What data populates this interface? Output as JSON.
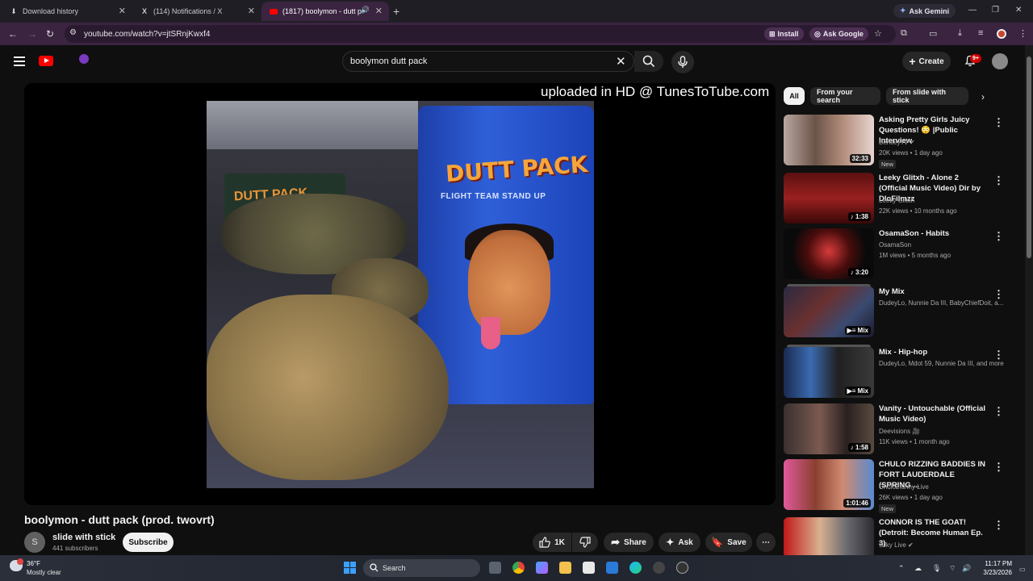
{
  "browser": {
    "tabs": [
      {
        "label": "Download history",
        "icon": "download-icon"
      },
      {
        "label": "(114) Notifications / X",
        "icon": "x-logo-icon"
      },
      {
        "label": "(1817) boolymon - dutt pac",
        "icon": "youtube-icon"
      }
    ],
    "ask_gemini": "Ask Gemini",
    "url": "youtube.com/watch?v=jtSRnjKwxf4",
    "install": "Install",
    "ask_google": "Ask Google"
  },
  "header": {
    "search_value": "boolymon dutt pack",
    "create_label": "Create",
    "notif_badge": "9+"
  },
  "player": {
    "watermark": "uploaded in HD @ TunesToTube.com",
    "art_bag_title": "DUTT PACK",
    "art_bag_subtitle": "FLIGHT TEAM STAND UP",
    "art_small_bag": "DUTT PACK"
  },
  "video": {
    "title": "boolymon - dutt pack (prod. twovrt)",
    "channel_initial": "S",
    "channel": "slide with stick",
    "subscribers": "441 subscribers",
    "subscribe_label": "Subscribe",
    "likes": "1K",
    "share_label": "Share",
    "ask_label": "Ask",
    "save_label": "Save"
  },
  "chips": [
    "All",
    "From your search",
    "From slide with stick"
  ],
  "recommendations": [
    {
      "title": "Asking Pretty Girls Juicy Questions! 😳 |Public Interview",
      "channel": "BentleyTv",
      "verified": true,
      "meta": "20K views • 1 day ago",
      "badge": "New",
      "duration": "32:33"
    },
    {
      "title": "Leeky Glitxh - Alone 2 (Official Music Video) Dir by DloFilmzz",
      "channel": "Leeky Glitxh",
      "meta": "22K views • 10 months ago",
      "duration": "1:38"
    },
    {
      "title": "OsamaSon - Habits",
      "channel": "OsamaSon",
      "meta": "1M views • 5 months ago",
      "duration": "3:20"
    },
    {
      "title": "My Mix",
      "channel": "DudeyLo, Nunnie Da III, BabyChiefDoit, a...",
      "duration": "Mix"
    },
    {
      "title": "Mix - Hip-hop",
      "channel": "DudeyLo, Mdot 59, Nunnie Da III, and more",
      "duration": "Mix"
    },
    {
      "title": "Vanity - Untouchable (Official Music Video)",
      "channel": "Deevisions 🎥",
      "meta": "11K views • 1 month ago",
      "duration": "1:58"
    },
    {
      "title": "CHULO RIZZING BADDIES IN FORT LAUDERDALE (SPRING ...",
      "channel": "Chulo2funny Live",
      "meta": "26K views • 1 day ago",
      "badge": "New",
      "duration": "1:01:46"
    },
    {
      "title": "CONNOR IS THE GOAT! (Detroit: Become Human Ep. 3)",
      "channel": "Silky Live",
      "verified": true,
      "meta": "",
      "duration": ""
    }
  ],
  "taskbar": {
    "temp": "36°F",
    "condition": "Mostly clear",
    "search_label": "Search",
    "time": "11:17 PM",
    "date": "3/23/2026"
  }
}
